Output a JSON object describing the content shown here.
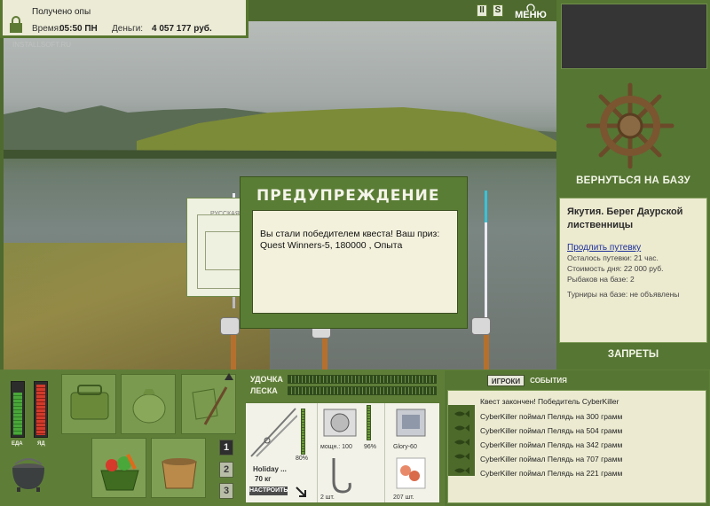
{
  "info": {
    "message": "Получено опы",
    "time_label": "Время:",
    "time_value": "05:50 ПН",
    "money_label": "Деньги:",
    "money_value": "4 057 177 руб."
  },
  "watermark": "INSTALLSOFT.RU",
  "top_buttons": {
    "pause": "II",
    "speed": "S",
    "menu": "МЕНЮ"
  },
  "right_panel": {
    "back_label": "ВЕРНУТЬСЯ НА БАЗУ",
    "location_title": "Якутия. Берег Даурской лиственницы",
    "extend_link": "Продлить путевку",
    "rows": [
      "Осталось путевки: 21 час.",
      "Стоимость дня: 22 000 руб.",
      "Рыбаков на базе: 2"
    ],
    "tournaments": "Турниры на базе: не объявлены",
    "bans_label": "ЗАПРЕТЫ"
  },
  "background_dialog": {
    "label": "РУССКАЯ"
  },
  "warning": {
    "title": "ПРЕДУПРЕЖДЕНИЕ",
    "text": "Вы стали победителем квеста! Ваш приз: Quest Winners-5, 180000 , Опыта"
  },
  "gauges": {
    "food_label": "ЕДА",
    "poison_label": "ЯД",
    "food_level": 0.78,
    "poison_level": 0.92
  },
  "pages": [
    "1",
    "2",
    "3"
  ],
  "tackle": {
    "rod_label": "УДОЧКА",
    "line_label": "ЛЕСКА",
    "rod_name": "Holiday ...",
    "rod_weight": "70 кг",
    "rod_wear": "80%",
    "reel_label": "мощн.: 100",
    "reel_wear": "96%",
    "line_name": "Glory-60",
    "hook_count": "2 шт.",
    "bait_count": "207 шт.",
    "tune_label": "НАСТРОИТЬ"
  },
  "log": {
    "tab_players": "ИГРОКИ",
    "tab_events": "СОБЫТИЯ",
    "header": "Квест закончен! Победитель CyberKiller",
    "rows": [
      "CyberKiller поймал Пелядь на 300 грамм",
      "CyberKiller поймал Пелядь на 504 грамм",
      "CyberKiller поймал Пелядь на 342 грамм",
      "CyberKiller поймал Пелядь на 707 грамм",
      "CyberKiller поймал Пелядь на 221 грамм"
    ]
  }
}
